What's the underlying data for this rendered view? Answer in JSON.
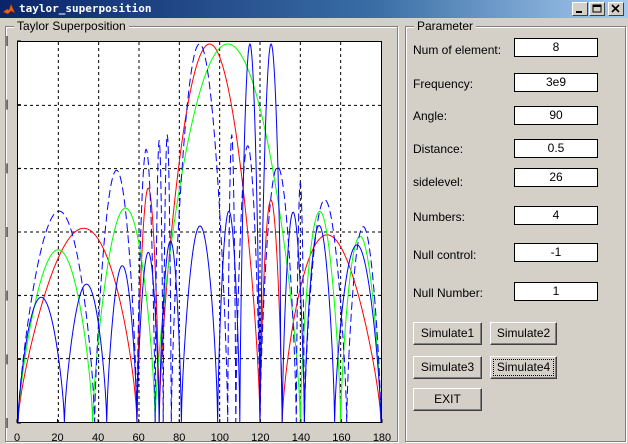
{
  "window": {
    "title": "taylor_superposition",
    "icons": [
      "matlab-logo-icon",
      "minimize-icon",
      "maximize-icon",
      "close-icon"
    ]
  },
  "plot_group": {
    "label": "Taylor Superposition"
  },
  "param_group": {
    "label": "Parameter",
    "fields": [
      {
        "label": "Num of element:",
        "value": "8"
      },
      {
        "label": "Frequency:",
        "value": "3e9"
      },
      {
        "label": "Angle:",
        "value": "90"
      },
      {
        "label": "Distance:",
        "value": "0.5"
      },
      {
        "label": "sidelevel:",
        "value": "26"
      },
      {
        "label": "Numbers:",
        "value": "4"
      },
      {
        "label": "Null control:",
        "value": "-1"
      },
      {
        "label": "Null Number:",
        "value": "1"
      }
    ]
  },
  "buttons": {
    "simulate1": "Simulate1",
    "simulate2": "Simulate2",
    "simulate3": "Simulate3",
    "simulate4": "Simulate4",
    "exit": "EXIT"
  },
  "chart_data": {
    "type": "line",
    "title": "",
    "xlabel": "",
    "ylabel": "",
    "xlim": [
      0,
      180
    ],
    "x_ticks": [
      "0",
      "20",
      "40",
      "60",
      "80",
      "100",
      "120",
      "140",
      "160",
      "180"
    ],
    "y_ticks_visible": 7,
    "grid": true,
    "colors": {
      "red": "#ff0000",
      "green": "#00ff00",
      "blue": "#0000ff"
    },
    "series": [
      {
        "color": "#ff0000",
        "style": "solid",
        "main_lobe_center": 90,
        "main_lobe_halfwidth": 12,
        "nulls": [
          59,
          70,
          120,
          131
        ],
        "sidelobe_level": 0.7
      },
      {
        "color": "#00ff00",
        "style": "solid",
        "main_lobe_center": 100,
        "main_lobe_halfwidth": 14,
        "nulls": [
          37,
          68,
          140,
          160
        ],
        "sidelobe_level": 0.72
      },
      {
        "color": "#0000ff",
        "style": "dashed",
        "main_lobe_center": 90,
        "main_lobe_halfwidth": 8,
        "nulls": [
          38,
          59,
          68,
          72,
          76,
          104,
          108,
          120,
          138,
          142,
          163
        ],
        "sidelobe_level": 0.82
      },
      {
        "color": "#0000ff",
        "style": "solid",
        "main_lobe_center": 120,
        "main_lobe_halfwidth": 10,
        "nulls": [
          23,
          44,
          59,
          70,
          81,
          99,
          110,
          120,
          131,
          142,
          157
        ],
        "sidelobe_level": 0.6
      }
    ]
  }
}
